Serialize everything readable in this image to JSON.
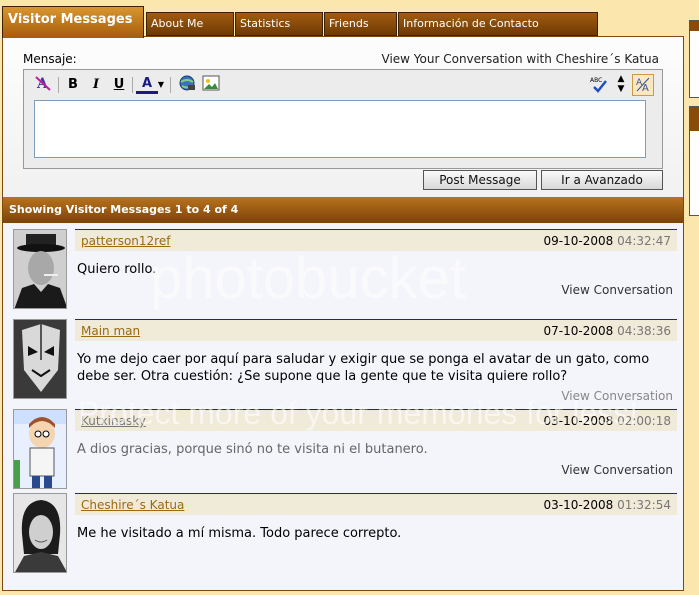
{
  "tabs": [
    {
      "label": "Visitor Messages"
    },
    {
      "label": "About Me"
    },
    {
      "label": "Statistics"
    },
    {
      "label": "Friends"
    },
    {
      "label": "Información de Contacto"
    }
  ],
  "editor": {
    "label": "Mensaje:",
    "conversation_link": "View Your Conversation with Cheshire´s Katua",
    "toolbar": {
      "bold": "B",
      "italic": "I",
      "underline": "U",
      "font_color": "A",
      "spell": "ABC",
      "switch_mode": "A"
    },
    "textarea_value": "",
    "post_button": "Post Message",
    "advanced_button": "Ir a Avanzado"
  },
  "list": {
    "header": "Showing Visitor Messages 1 to 4 of 4",
    "messages": [
      {
        "user": "patterson12ref",
        "date": "09-10-2008",
        "time": "04:32:47",
        "text": "Quiero rollo.",
        "view": "View Conversation"
      },
      {
        "user": "Main man",
        "date": "07-10-2008",
        "time": "04:38:36",
        "text": "Yo me dejo caer por aquí para saludar y exigir que se ponga el avatar de un gato, como debe ser. Otra cuestión: ¿Se supone que la gente que te visita quiere rollo?",
        "view": "View Conversation"
      },
      {
        "user": "Kutxinasky",
        "date": "03-10-2008",
        "time": "02:00:18",
        "text": "A dios gracias, porque sinó no te visita ni el butanero.",
        "view": "View Conversation"
      },
      {
        "user": "Cheshire´s Katua",
        "date": "03-10-2008",
        "time": "01:32:54",
        "text": "Me he visitado a mí misma. Todo parece correpto.",
        "view": ""
      }
    ]
  },
  "watermark": {
    "line1": "photobucket",
    "line2": "Protect more of your memories for less!"
  },
  "colors": {
    "tab_active": "#d9962f",
    "tab": "#8a4a0a",
    "header": "#9a5a12",
    "page_bg": "#fbe7ad",
    "username": "#9a6a10"
  }
}
